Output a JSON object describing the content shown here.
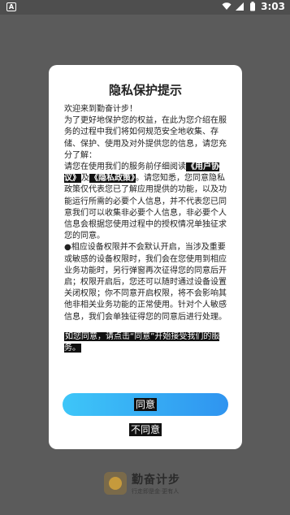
{
  "statusbar": {
    "time": "3:03",
    "notification_icon": "a-icon"
  },
  "dialog": {
    "title": "隐私保护提示",
    "greeting": "欢迎来到勤奋计步！",
    "para1": "为了更好地保护您的权益，在此为您介绍在服务的过程中我们将如何规范安全地收集、存储、保护、使用及对外提供您的信息，请您充分了解：",
    "para2_prefix": "请您在使用我们的服务前仔细阅读",
    "user_agreement_link": "《用户协议》",
    "and_text": "及",
    "privacy_policy_link": "《隐私政策》",
    "para2_suffix": "。请您知悉，您同意隐私政策仅代表您已了解应用提供的功能，以及功能运行所需的必要个人信息，并不代表您已同意我们可以收集非必要个人信息，非必要个人信息会根据您使用过程中的授权情况单独征求您的同意。",
    "para3": "●相应设备权限并不会默认开启，当涉及重要或敏感的设备权限时，我们会在您使用到相应业务功能时，另行弹窗再次征得您的同意后开启；权限开启后，您还可以随时通过设备设置关闭权限；你不同意开启权限，将不会影响其他非相关业务功能的正常使用。针对个人敏感信息，我们会单独征得您的同意后进行处理。",
    "closing": "如您同意，请点击“同意”开始接受我们的服务。",
    "agree_label": "同意",
    "disagree_label": "不同意"
  },
  "brand": {
    "name": "勤奋计步",
    "slogan": "行走即是金·更有人"
  }
}
